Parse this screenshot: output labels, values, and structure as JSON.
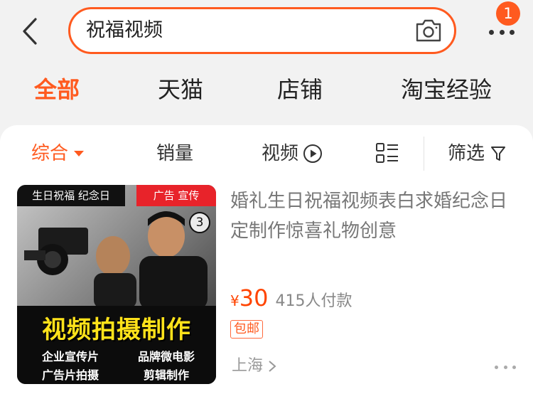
{
  "search": {
    "query": "祝福视频"
  },
  "header": {
    "badge_count": "1"
  },
  "scope_tabs": [
    {
      "label": "全部",
      "active": true
    },
    {
      "label": "天猫",
      "active": false
    },
    {
      "label": "店铺",
      "active": false
    },
    {
      "label": "淘宝经验",
      "active": false
    }
  ],
  "sort_bar": {
    "comprehensive": "综合",
    "sales": "销量",
    "video": "视频",
    "filter": "筛选"
  },
  "product": {
    "thumb": {
      "tag_left": "生日祝福 纪念日",
      "tag_right": "广告 宣传",
      "counter": "3",
      "headline": "视频拍摄制作",
      "sub_1": "企业宣传片",
      "sub_2": "品牌微电影",
      "sub_3": "广告片拍摄",
      "sub_4": "剪辑制作"
    },
    "title": "婚礼生日祝福视频表白求婚纪念日定制作惊喜礼物创意",
    "currency": "¥",
    "price": "30",
    "sales": "415人付款",
    "shipping": "包邮",
    "location": "上海"
  },
  "colors": {
    "accent": "#ff5a1f",
    "price": "#ff4400",
    "thumb_headline": "#ffe21a",
    "thumb_tag_red": "#e8232a"
  },
  "icons": [
    "chevron-left-icon",
    "camera-icon",
    "more-icon",
    "caret-down-icon",
    "play-circle-icon",
    "list-layout-icon",
    "filter-icon",
    "chevron-right-icon",
    "more-options-icon"
  ]
}
